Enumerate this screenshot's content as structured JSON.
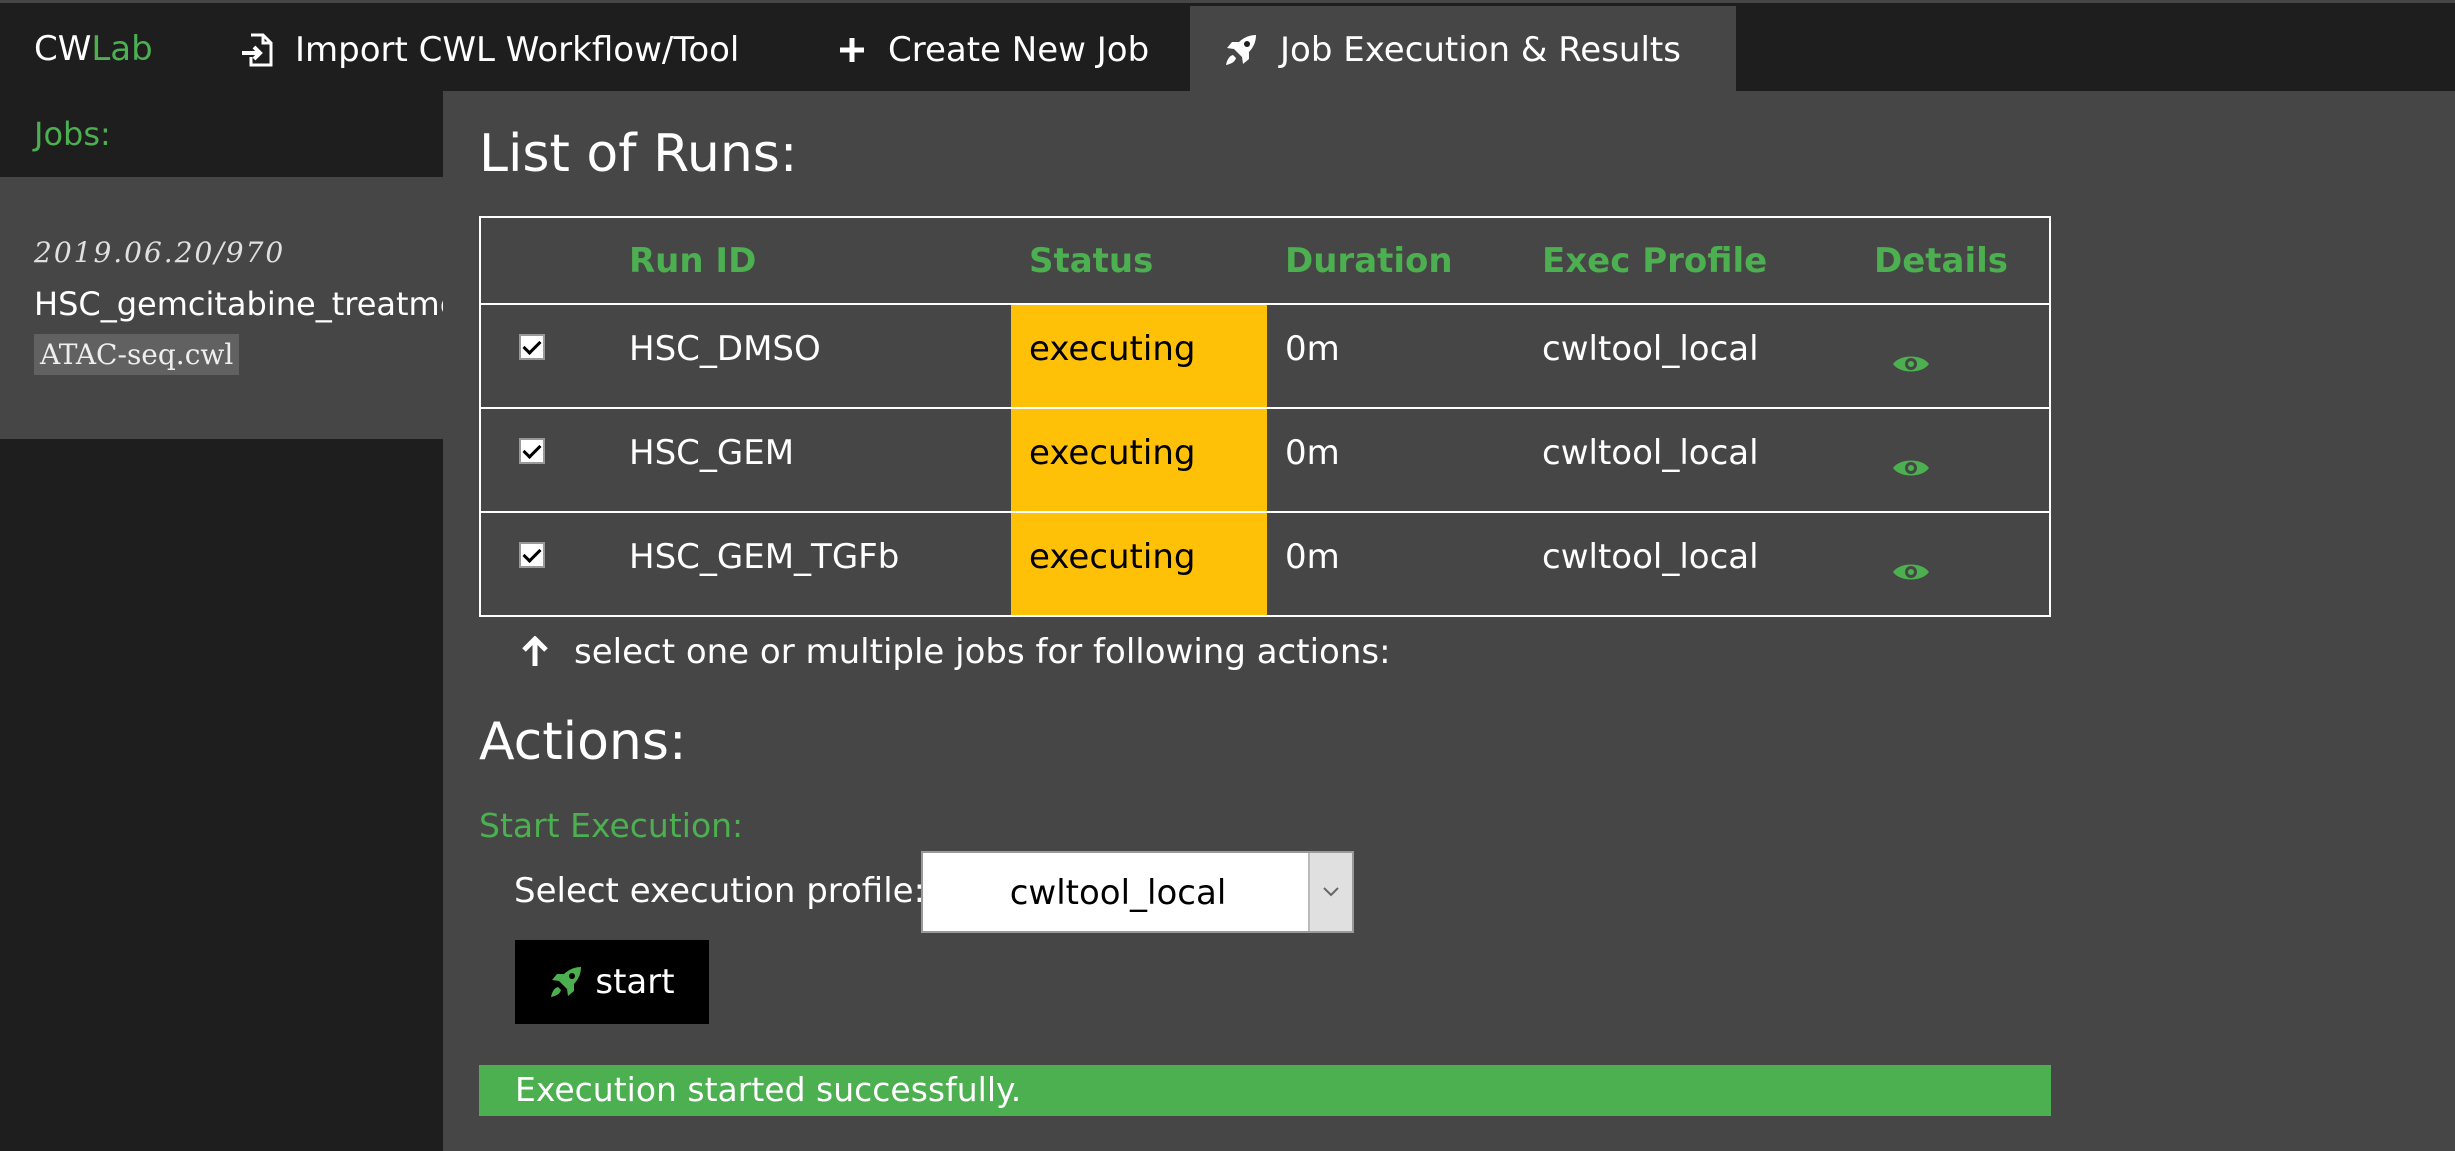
{
  "nav": {
    "brand_cw": "CW",
    "brand_lab": "Lab",
    "items": [
      {
        "label": "Import CWL Workflow/Tool",
        "icon": "file-import-icon"
      },
      {
        "label": "Create New Job",
        "icon": "plus-icon"
      },
      {
        "label": "Job Execution & Results",
        "icon": "rocket-icon",
        "active": true
      }
    ]
  },
  "sidebar": {
    "title": "Jobs:",
    "job": {
      "date": "2019.06.20/970",
      "name": "HSC_gemcitabine_treatment",
      "file": "ATAC-seq.cwl"
    }
  },
  "main": {
    "title": "List of Runs:",
    "columns": [
      "Run ID",
      "Status",
      "Duration",
      "Exec Profile",
      "Details"
    ],
    "rows": [
      {
        "checked": true,
        "run_id": "HSC_DMSO",
        "status": "executing",
        "duration": "0m",
        "exec_profile": "cwltool_local"
      },
      {
        "checked": true,
        "run_id": "HSC_GEM",
        "status": "executing",
        "duration": "0m",
        "exec_profile": "cwltool_local"
      },
      {
        "checked": true,
        "run_id": "HSC_GEM_TGFb",
        "status": "executing",
        "duration": "0m",
        "exec_profile": "cwltool_local"
      }
    ],
    "hint": "select one or multiple jobs for following actions:",
    "actions_title": "Actions:",
    "start_execution": "Start Execution:",
    "profile_label": "Select execution profile:",
    "profile_value": "cwltool_local",
    "start_button": "start",
    "success_message": "Execution started successfully."
  },
  "colors": {
    "accent": "#4caf50",
    "status_executing": "#ffc107",
    "background": "#464646",
    "nav_background": "#1e1e1e"
  }
}
